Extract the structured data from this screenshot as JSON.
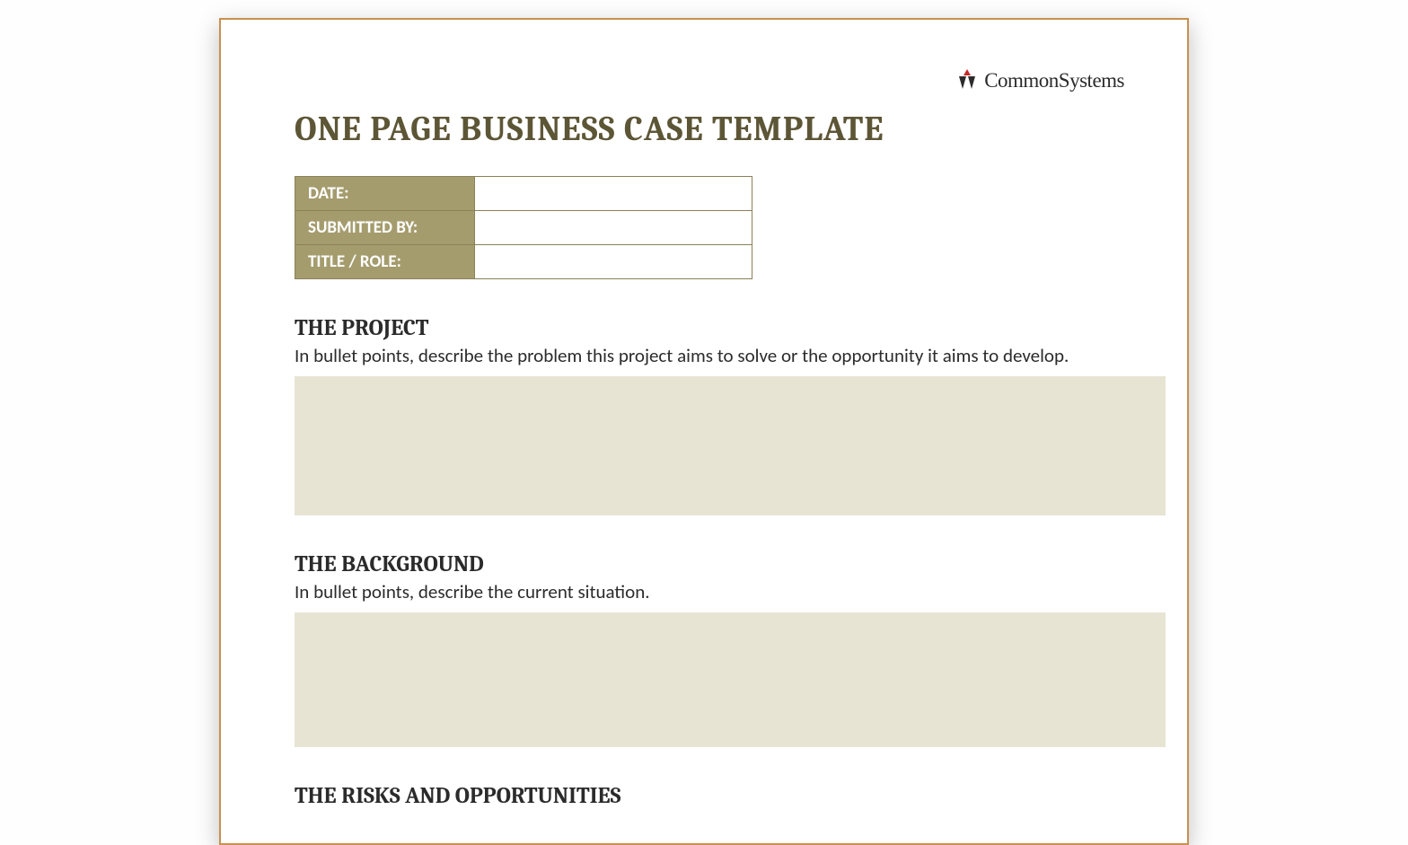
{
  "logo": {
    "text": "CommonSystems"
  },
  "title": "ONE PAGE BUSINESS CASE TEMPLATE",
  "meta": {
    "rows": [
      {
        "label": "DATE:",
        "value": ""
      },
      {
        "label": "SUBMITTED BY:",
        "value": ""
      },
      {
        "label": "TITLE / ROLE:",
        "value": ""
      }
    ]
  },
  "sections": [
    {
      "heading": "THE PROJECT",
      "description": "In bullet points, describe the problem this project aims to solve or the opportunity it aims to develop."
    },
    {
      "heading": "THE BACKGROUND",
      "description": "In bullet points, describe the current situation."
    },
    {
      "heading": "THE RISKS AND OPPORTUNITIES",
      "description": ""
    }
  ]
}
